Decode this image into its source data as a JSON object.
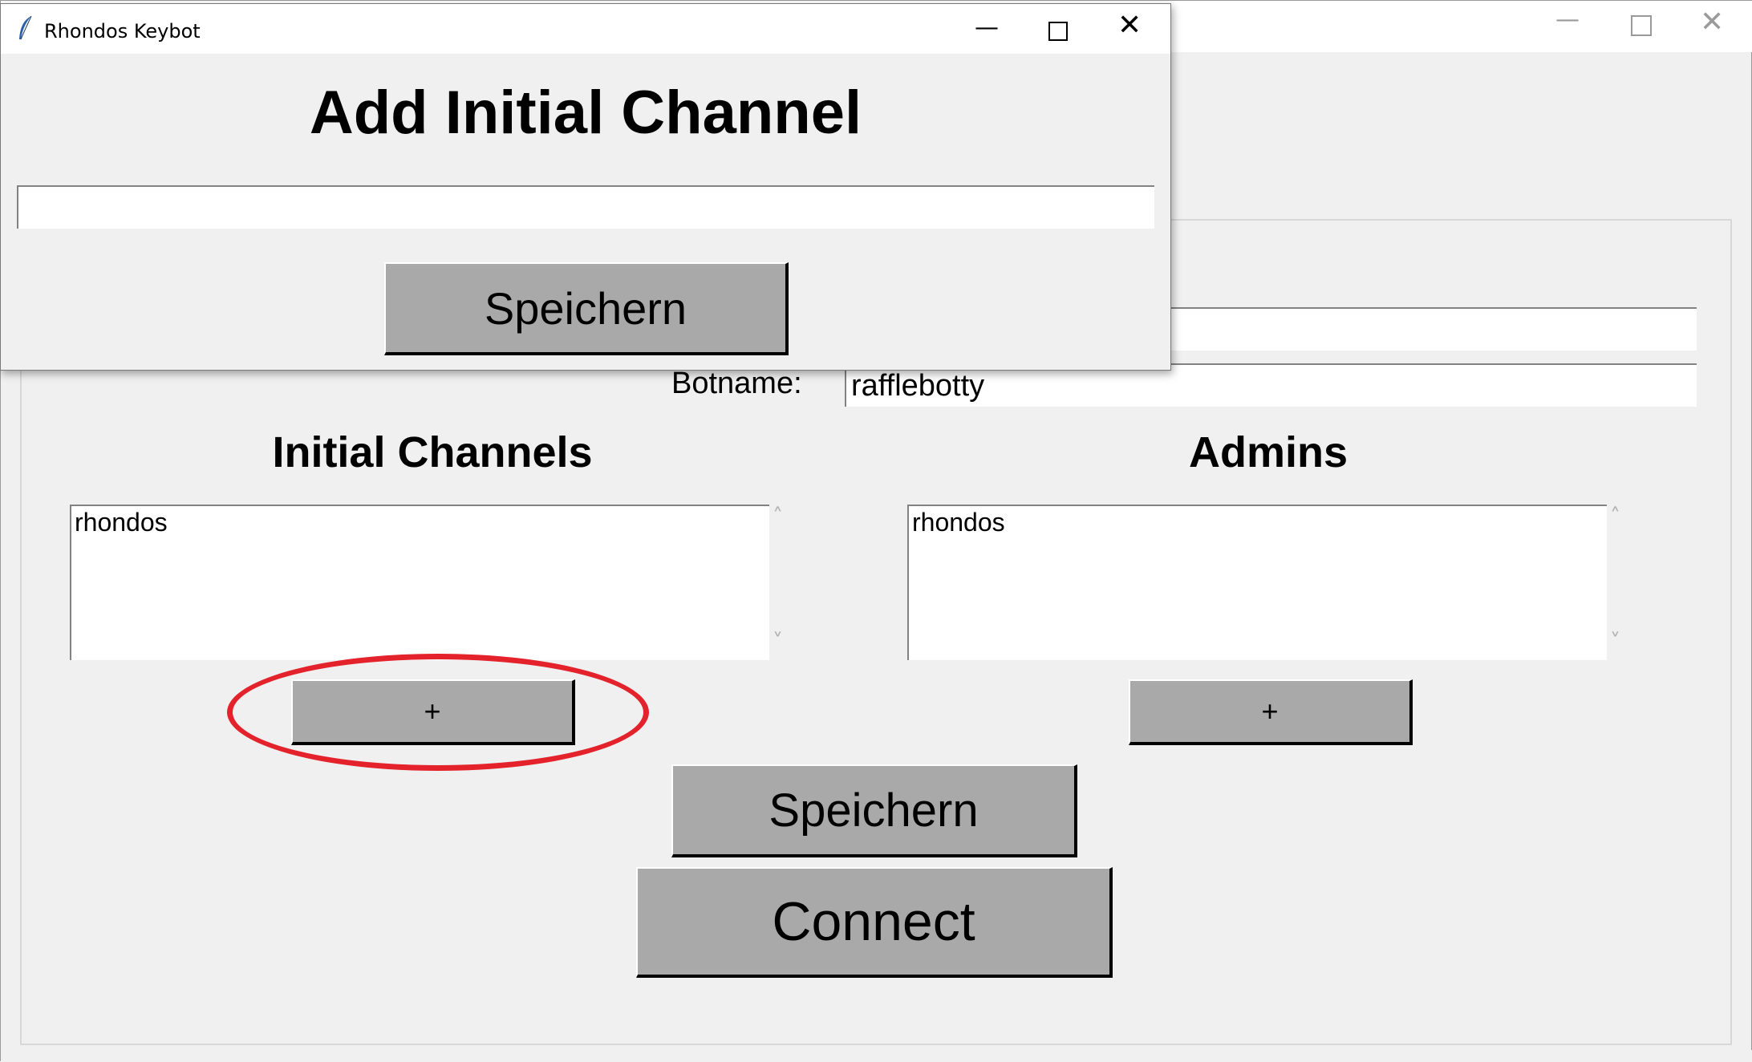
{
  "main_window": {
    "token_value": "*************",
    "botname_label": "Botname:",
    "botname_value": "rafflebotty",
    "channels_heading": "Initial Channels",
    "channels_list": [
      "rhondos"
    ],
    "admins_heading": "Admins",
    "admins_list": [
      "rhondos"
    ],
    "add_channel_label": "+",
    "add_admin_label": "+",
    "save_label": "Speichern",
    "connect_label": "Connect",
    "highlight_color": "#e3222b"
  },
  "dialog": {
    "title": "Rhondos Keybot",
    "heading": "Add Initial Channel",
    "input_value": "",
    "save_label": "Speichern"
  }
}
